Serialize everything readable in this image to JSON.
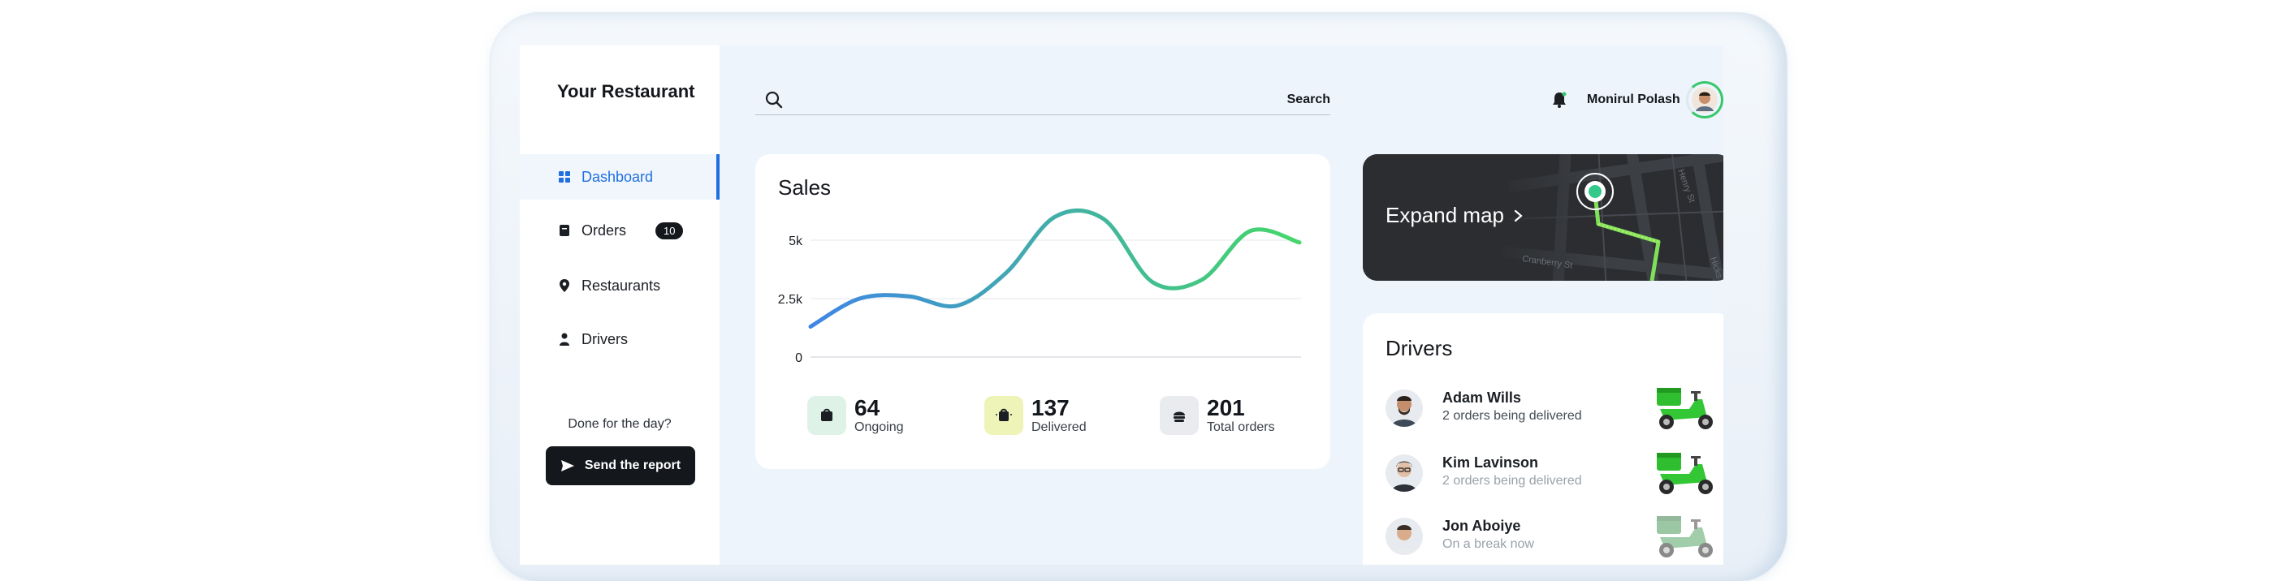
{
  "brand": "Your Restaurant",
  "nav": {
    "items": [
      {
        "label": "Dashboard",
        "icon": "grid-icon",
        "active": true
      },
      {
        "label": "Orders",
        "icon": "receipt-icon",
        "badge": "10"
      },
      {
        "label": "Restaurants",
        "icon": "location-pin-icon"
      },
      {
        "label": "Drivers",
        "icon": "driver-icon"
      }
    ]
  },
  "sidebar_footer": {
    "text": "Done for the day?",
    "button": "Send the report"
  },
  "search": {
    "label": "Search",
    "placeholder": ""
  },
  "user": {
    "name": "Monirul Polash"
  },
  "sales": {
    "title": "Sales",
    "stats": [
      {
        "value": "64",
        "label": "Ongoing",
        "color": "#dff2e8"
      },
      {
        "value": "137",
        "label": "Delivered",
        "color": "#eef3b8"
      },
      {
        "value": "201",
        "label": "Total orders",
        "color": "#e9ebee"
      }
    ]
  },
  "chart_data": {
    "type": "line",
    "title": "Sales",
    "y_ticks": [
      "0",
      "2.5k",
      "5k"
    ],
    "ylim": [
      0,
      5000
    ],
    "x": [
      0,
      1,
      2,
      3,
      4,
      5,
      6,
      7,
      8,
      9,
      10
    ],
    "series": [
      {
        "values": [
          1300,
          2500,
          2600,
          2200,
          3600,
          6000,
          5900,
          3200,
          3300,
          5400,
          4900
        ]
      }
    ],
    "grid": true,
    "gradient": [
      "#3f86e6",
      "#45d76a"
    ]
  },
  "map": {
    "label": "Expand map",
    "streets": [
      "Cranberry St",
      "Henry St",
      "Hicks St"
    ]
  },
  "drivers": {
    "title": "Drivers",
    "items": [
      {
        "name": "Adam Wills",
        "status": "2 orders being delivered"
      },
      {
        "name": "Kim Lavinson",
        "status": "2 orders being delivered"
      },
      {
        "name": "Jon Aboiye",
        "status": "On a break now"
      }
    ]
  }
}
